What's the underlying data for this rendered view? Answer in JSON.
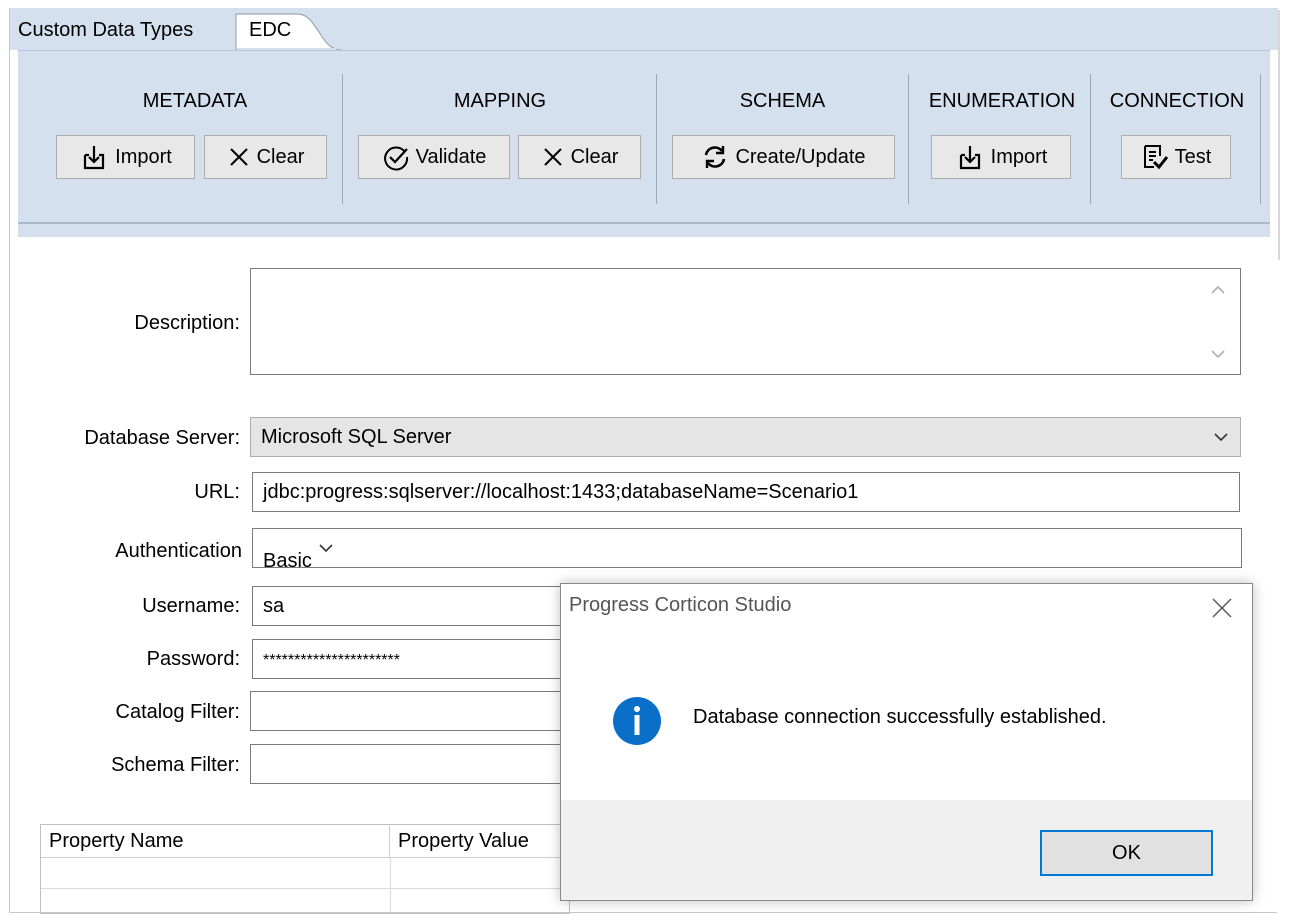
{
  "tabs": [
    {
      "label": "Custom Data Types"
    },
    {
      "label": "EDC"
    }
  ],
  "ribbon": {
    "groups": [
      {
        "title": "METADATA",
        "buttons": [
          {
            "label": "Import",
            "icon": "import-icon"
          },
          {
            "label": "Clear",
            "icon": "close-x-icon"
          }
        ]
      },
      {
        "title": "MAPPING",
        "buttons": [
          {
            "label": "Validate",
            "icon": "validate-check-icon"
          },
          {
            "label": "Clear",
            "icon": "close-x-icon"
          }
        ]
      },
      {
        "title": "SCHEMA",
        "buttons": [
          {
            "label": "Create/Update",
            "icon": "refresh-icon"
          }
        ]
      },
      {
        "title": "ENUMERATION",
        "buttons": [
          {
            "label": "Import",
            "icon": "import-icon"
          }
        ]
      },
      {
        "title": "CONNECTION",
        "buttons": [
          {
            "label": "Test",
            "icon": "test-document-icon"
          }
        ]
      }
    ]
  },
  "form": {
    "description_label": "Description:",
    "description_value": "",
    "db_server_label": "Database Server:",
    "db_server_value": "Microsoft SQL Server",
    "url_label": "URL:",
    "url_value": "jdbc:progress:sqlserver://localhost:1433;databaseName=Scenario1",
    "auth_label": "Authentication",
    "auth_value": "Basic",
    "username_label": "Username:",
    "username_value": "sa",
    "password_label": "Password:",
    "password_value": "**********************",
    "catalog_label": "Catalog Filter:",
    "catalog_value": "",
    "schema_label": "Schema Filter:",
    "schema_value": ""
  },
  "properties_table": {
    "columns": [
      "Property Name",
      "Property Value"
    ]
  },
  "dialog": {
    "title": "Progress Corticon Studio",
    "message": "Database connection successfully established.",
    "ok_label": "OK",
    "icon": "info-icon",
    "icon_color": "#0a6fc9"
  },
  "colors": {
    "ribbon_bg": "#d4e0ee",
    "accent": "#0078d7"
  }
}
